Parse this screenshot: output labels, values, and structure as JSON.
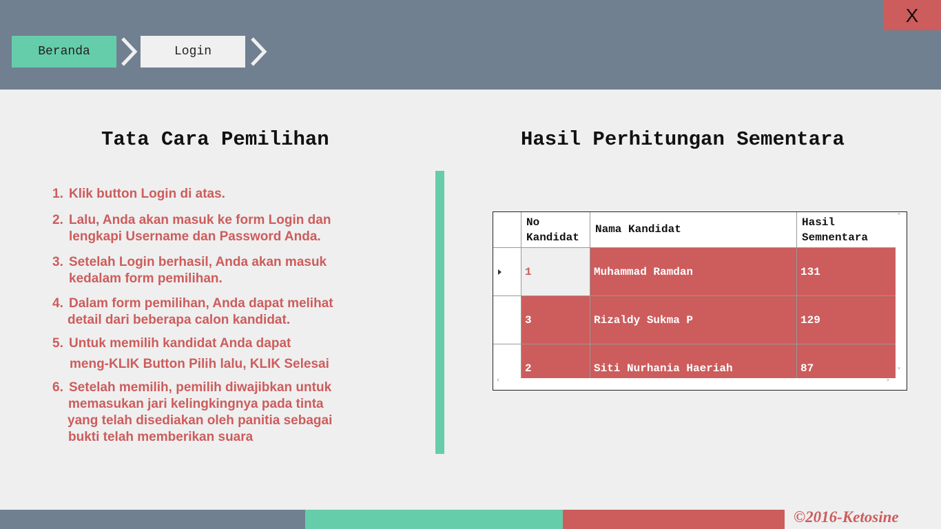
{
  "window": {
    "close_label": "X"
  },
  "nav": {
    "beranda_label": "Beranda",
    "login_label": "Login"
  },
  "left_panel": {
    "title": "Tata Cara Pemilihan",
    "steps": [
      {
        "num": "1.",
        "line1": "Klik button Login di atas.",
        "line2": ""
      },
      {
        "num": "2.",
        "line1": "Lalu, Anda akan masuk ke form Login dan",
        "line2": "lengkapi Username dan Password Anda."
      },
      {
        "num": "3.",
        "line1": "Setelah Login berhasil, Anda akan masuk",
        "line2": "kedalam form pemilihan."
      },
      {
        "num": "4.",
        "line1": "Dalam form pemilihan, Anda dapat melihat",
        "line2": "detail dari beberapa calon kandidat."
      },
      {
        "num": "5.",
        "line1": "Untuk memilih kandidat Anda dapat",
        "line2": "meng-KLIK Button Pilih lalu, KLIK Selesai"
      },
      {
        "num": "6.",
        "line1": "Setelah memilih, pemilih diwajibkan untuk",
        "line2": "memasukan jari kelingkingnya pada tinta",
        "line3": "yang telah disediakan oleh panitia sebagai",
        "line4": "bukti telah memberikan suara"
      }
    ]
  },
  "right_panel": {
    "title": "Hasil Perhitungan Sementara",
    "table": {
      "headers": {
        "no_line1": "No",
        "no_line2": "Kandidat",
        "nama": "Nama Kandidat",
        "hasil_line1": "Hasil",
        "hasil_line2": "Semnentara"
      },
      "rows": [
        {
          "no": "1",
          "nama": "Muhammad Ramdan",
          "hasil": "131"
        },
        {
          "no": "3",
          "nama": "Rizaldy Sukma P",
          "hasil": "129"
        },
        {
          "no": "2",
          "nama": "Siti Nurhania Haeriah",
          "hasil": "87"
        }
      ]
    }
  },
  "footer": {
    "copyright": "©2016-Ketosine"
  },
  "colors": {
    "slate": "#708090",
    "teal": "#66cdaa",
    "red": "#cd5c5c",
    "background": "#efefef"
  }
}
